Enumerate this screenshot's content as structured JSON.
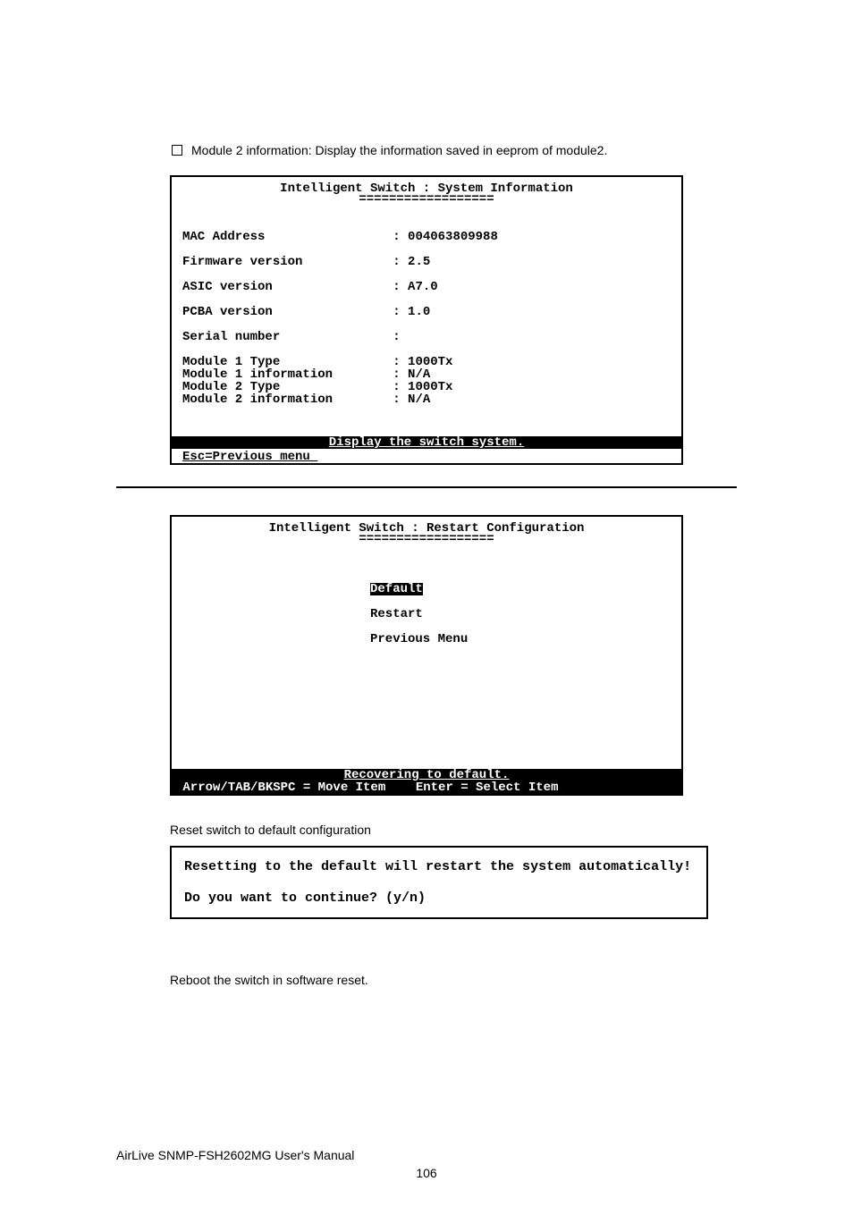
{
  "bullet_text": "Module 2 information: Display the information saved in eeprom of module2.",
  "term1": {
    "title": "Intelligent Switch : System Information",
    "underline": "==================",
    "rows": [
      {
        "label": "MAC Address",
        "value": "004063809988",
        "gap": true
      },
      {
        "label": "Firmware version",
        "value": "2.5",
        "gap": true
      },
      {
        "label": "ASIC version",
        "value": "A7.0",
        "gap": true
      },
      {
        "label": "PCBA version",
        "value": "1.0",
        "gap": true
      },
      {
        "label": "Serial number",
        "value": "",
        "gap": true
      },
      {
        "label": "Module 1 Type",
        "value": "1000Tx",
        "gap": false
      },
      {
        "label": "Module 1 information",
        "value": "N/A",
        "gap": false
      },
      {
        "label": "Module 2 Type",
        "value": "1000Tx",
        "gap": false
      },
      {
        "label": "Module 2 information",
        "value": "N/A",
        "gap": false
      }
    ],
    "status": "Display the switch system.",
    "prev": "Esc=Previous menu_"
  },
  "term2": {
    "title": "Intelligent Switch : Restart Configuration",
    "underline": "==================",
    "menu": [
      {
        "label": "Default",
        "selected": true
      },
      {
        "label": "Restart",
        "selected": false
      },
      {
        "label": "Previous Menu",
        "selected": false
      }
    ],
    "status": "Recovering to default.",
    "bottombar": " Arrow/TAB/BKSPC = Move Item    Enter = Select Item"
  },
  "reset_label": "Reset switch to default configuration",
  "confirm": {
    "line1": "Resetting to the default will restart the system automatically!",
    "line2": "Do you want to continue? (y/n)"
  },
  "reboot_label": "Reboot the switch in software reset.",
  "footer_left": "AirLive SNMP-FSH2602MG User's Manual",
  "page_number": "106"
}
